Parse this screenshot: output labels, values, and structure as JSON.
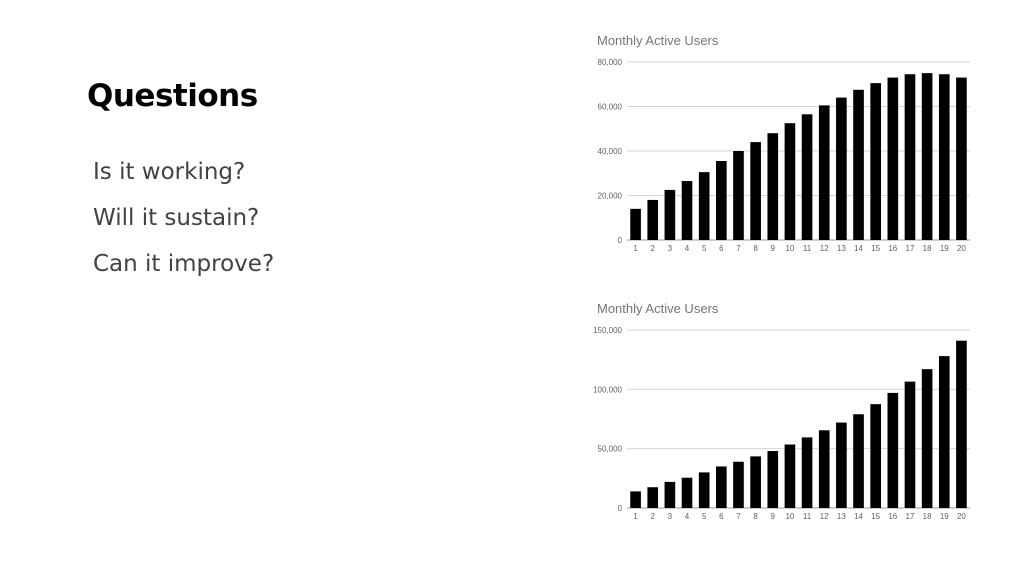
{
  "slide": {
    "title": "Questions",
    "bullets": [
      "Is it working?",
      "Will it sustain?",
      "Can it improve?"
    ]
  },
  "chart_data": [
    {
      "type": "bar",
      "title": "Monthly Active Users",
      "xlabel": "",
      "ylabel": "",
      "categories": [
        "1",
        "2",
        "3",
        "4",
        "5",
        "6",
        "7",
        "8",
        "9",
        "10",
        "11",
        "12",
        "13",
        "14",
        "15",
        "16",
        "17",
        "18",
        "19",
        "20"
      ],
      "values": [
        14000,
        18000,
        22500,
        26500,
        30500,
        35500,
        40000,
        44000,
        48000,
        52500,
        56500,
        60500,
        64000,
        67500,
        70500,
        73000,
        74500,
        75000,
        74500,
        73000
      ],
      "ylim": [
        0,
        80000
      ],
      "yticks": [
        0,
        20000,
        40000,
        60000,
        80000
      ],
      "ytick_labels": [
        "0",
        "20,000",
        "40,000",
        "60,000",
        "80,000"
      ],
      "grid": true,
      "bar_color": "#000000"
    },
    {
      "type": "bar",
      "title": "Monthly Active Users",
      "xlabel": "",
      "ylabel": "",
      "categories": [
        "1",
        "2",
        "3",
        "4",
        "5",
        "6",
        "7",
        "8",
        "9",
        "10",
        "11",
        "12",
        "13",
        "14",
        "15",
        "16",
        "17",
        "18",
        "19",
        "20"
      ],
      "values": [
        14000,
        17500,
        22000,
        25500,
        30000,
        35000,
        39000,
        43500,
        48000,
        53500,
        59500,
        65500,
        72000,
        79000,
        87500,
        97000,
        106500,
        117000,
        128000,
        141000
      ],
      "ylim": [
        0,
        150000
      ],
      "yticks": [
        0,
        50000,
        100000,
        150000
      ],
      "ytick_labels": [
        "0",
        "50,000",
        "100,000",
        "150,000"
      ],
      "grid": true,
      "bar_color": "#000000"
    }
  ]
}
